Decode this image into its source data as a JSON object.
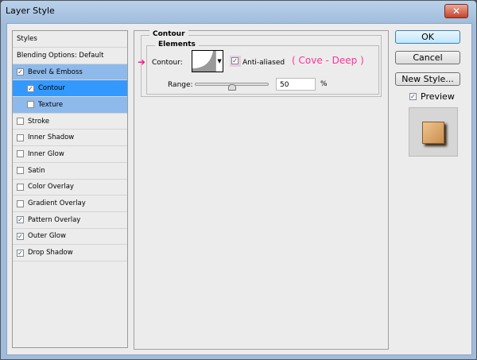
{
  "window": {
    "title": "Layer Style",
    "close": "✕"
  },
  "sidebar": {
    "header": "Styles",
    "items": [
      {
        "label": "Blending Options: Default"
      },
      {
        "label": "Bevel & Emboss",
        "checked": true
      },
      {
        "label": "Contour",
        "checked": true
      },
      {
        "label": "Texture",
        "checked": false
      },
      {
        "label": "Stroke",
        "checked": false
      },
      {
        "label": "Inner Shadow",
        "checked": false
      },
      {
        "label": "Inner Glow",
        "checked": false
      },
      {
        "label": "Satin",
        "checked": false
      },
      {
        "label": "Color Overlay",
        "checked": false
      },
      {
        "label": "Gradient Overlay",
        "checked": false
      },
      {
        "label": "Pattern Overlay",
        "checked": true
      },
      {
        "label": "Outer Glow",
        "checked": true
      },
      {
        "label": "Drop Shadow",
        "checked": true
      }
    ]
  },
  "contour": {
    "group_title": "Contour",
    "elements_title": "Elements",
    "contour_label": "Contour:",
    "anti_aliased_label": "Anti-aliased",
    "anti_aliased": true,
    "annotation": "( Cove - Deep )",
    "range_label": "Range:",
    "range_value": "50",
    "range_unit": "%",
    "range_fraction": 0.5
  },
  "buttons": {
    "ok": "OK",
    "cancel": "Cancel",
    "new_style": "New Style...",
    "preview_label": "Preview",
    "preview_checked": true
  },
  "colors": {
    "accent": "#ff1493",
    "selected": "#3399ff"
  }
}
